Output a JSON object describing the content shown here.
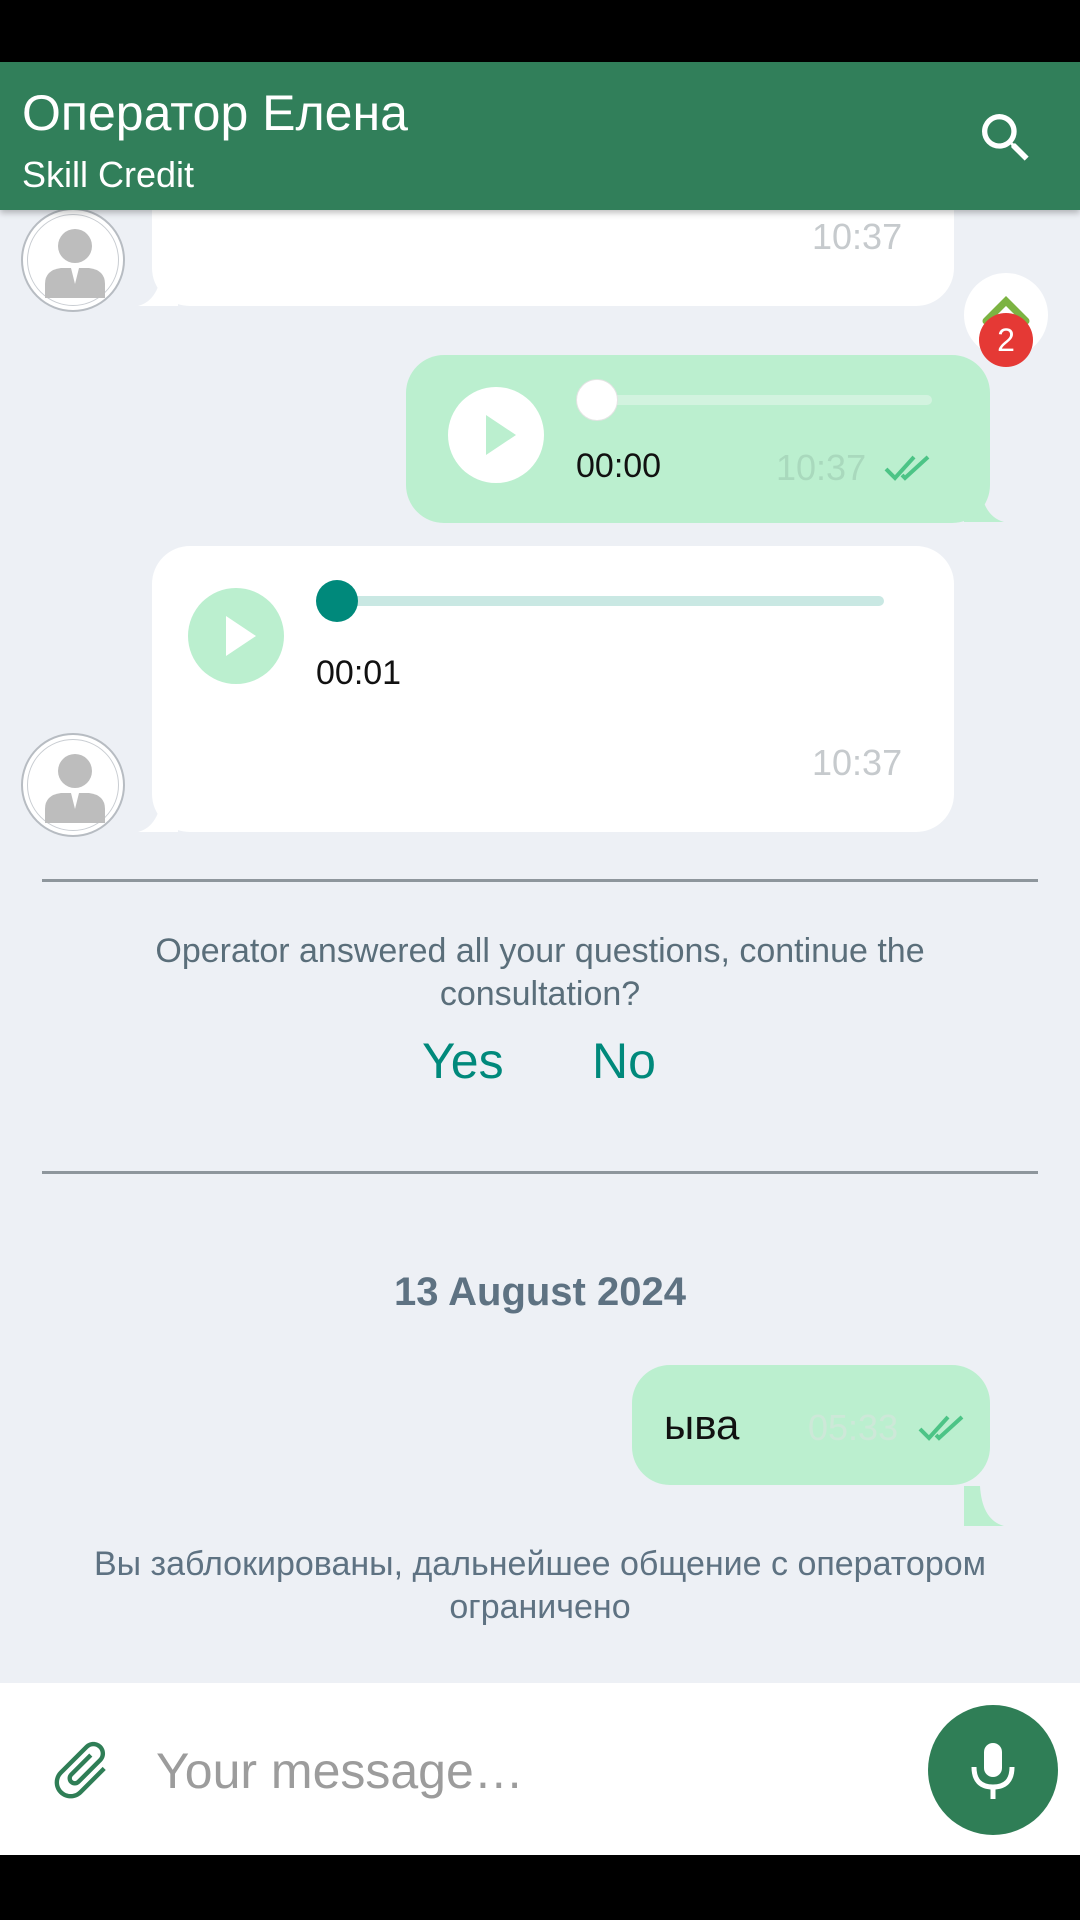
{
  "header": {
    "title": "Оператор Елена",
    "subtitle": "Skill Credit",
    "search_icon": "search-icon"
  },
  "messages": {
    "incoming_top": {
      "time": "10:37"
    },
    "outgoing_audio": {
      "duration": "00:00",
      "time": "10:37",
      "progress": 0
    },
    "incoming_audio": {
      "duration": "00:01",
      "time": "10:37",
      "progress": 0
    },
    "outgoing_text": {
      "text": "ыва",
      "time": "05:33"
    }
  },
  "scroll_badge": {
    "count": "2"
  },
  "survey": {
    "question": "Operator answered all your questions, continue the consultation?",
    "yes_label": "Yes",
    "no_label": "No"
  },
  "date_separator": "13 August 2024",
  "blocked_notice": "Вы заблокированы, дальнейшее общение с оператором ограничено",
  "composer": {
    "placeholder": "Your message…",
    "attach_icon": "paperclip-icon",
    "mic_icon": "microphone-icon"
  },
  "colors": {
    "header": "#317f5a",
    "outgoing_bubble": "#bbefcf",
    "accent": "#00897b",
    "background": "#edf0f5",
    "badge": "#e53935"
  }
}
